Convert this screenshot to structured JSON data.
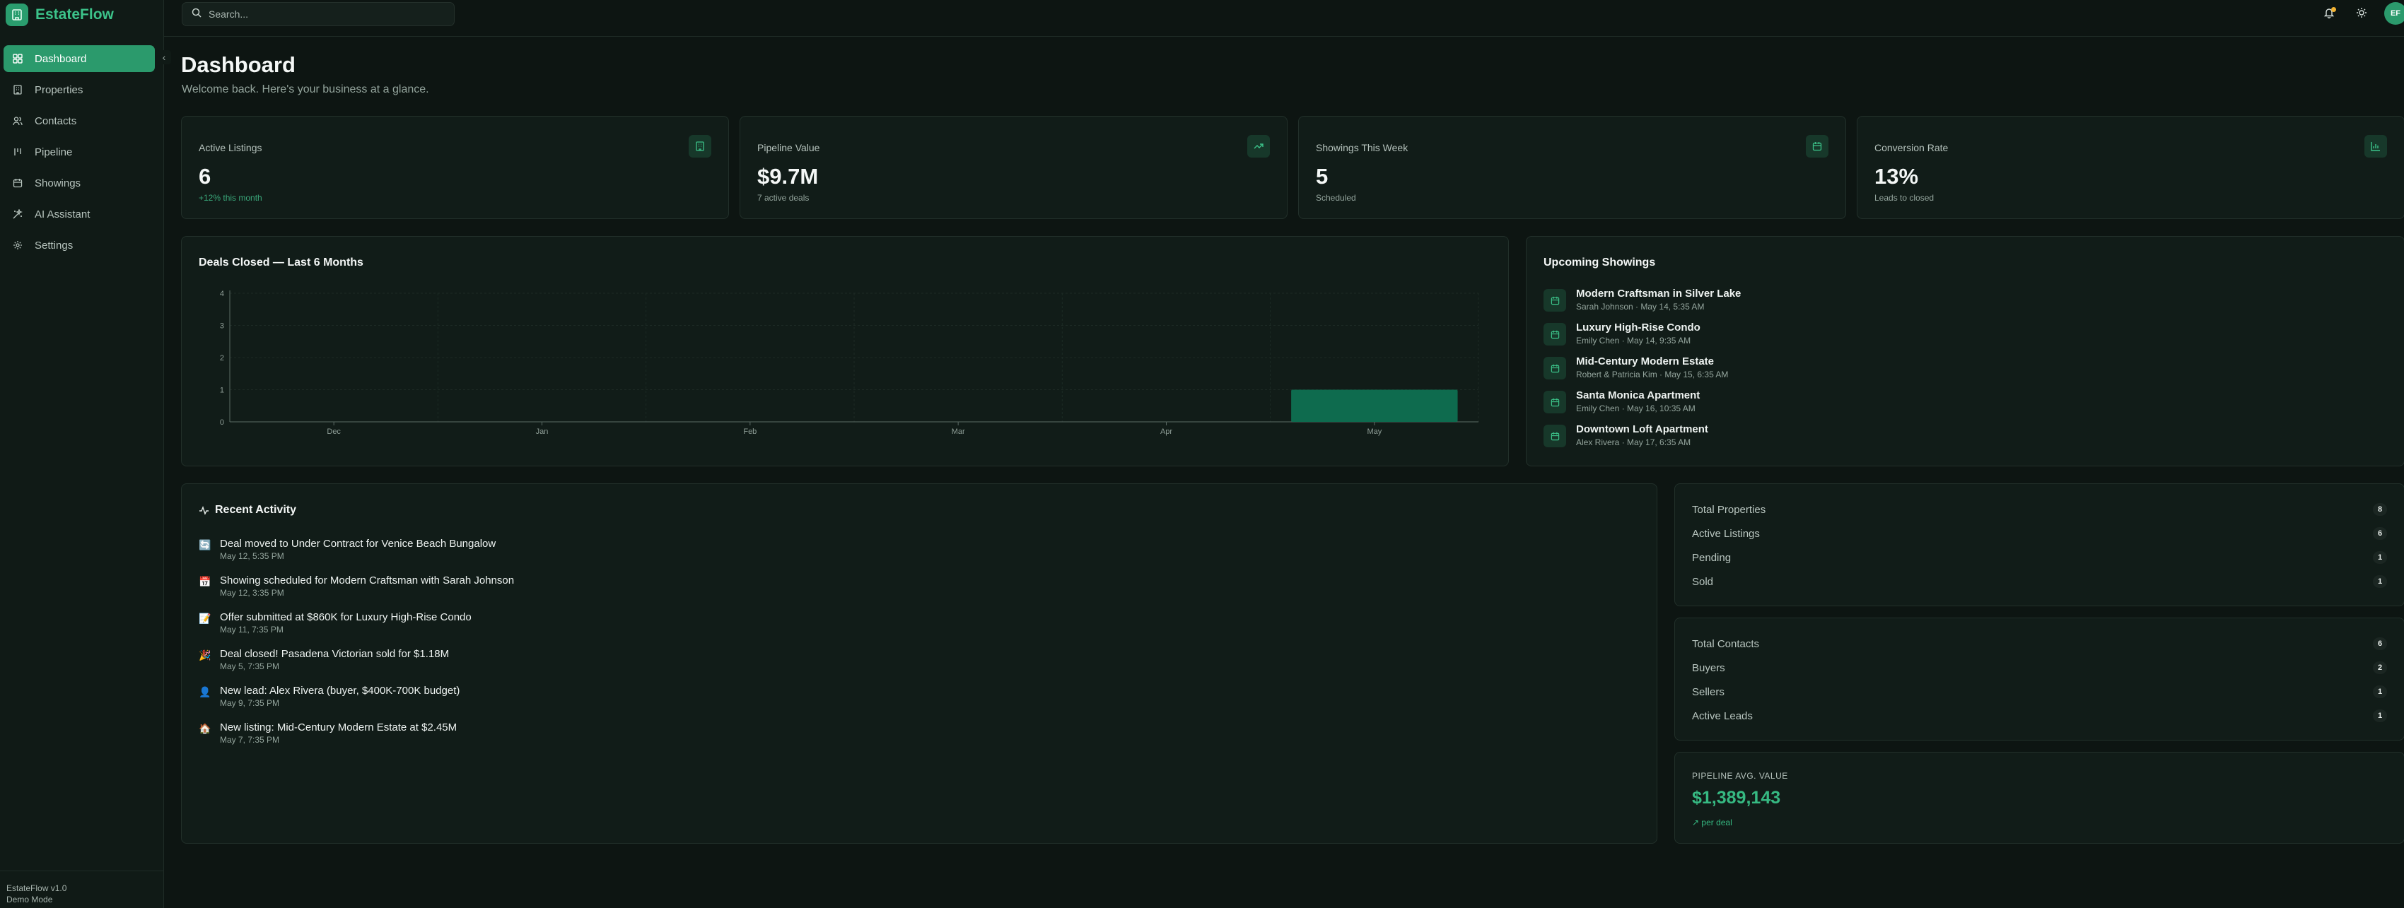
{
  "app": {
    "name": "EstateFlow",
    "version": "EstateFlow v1.0",
    "mode": "Demo Mode"
  },
  "search": {
    "placeholder": "Search..."
  },
  "user": {
    "initials": "EF"
  },
  "nav": {
    "items": [
      {
        "label": "Dashboard",
        "icon": "dashboard-icon",
        "active": true
      },
      {
        "label": "Properties",
        "icon": "building-icon"
      },
      {
        "label": "Contacts",
        "icon": "users-icon"
      },
      {
        "label": "Pipeline",
        "icon": "kanban-icon"
      },
      {
        "label": "Showings",
        "icon": "calendar-icon"
      },
      {
        "label": "AI Assistant",
        "icon": "sparkles-icon"
      },
      {
        "label": "Settings",
        "icon": "gear-icon"
      }
    ]
  },
  "header": {
    "title": "Dashboard",
    "subtitle": "Welcome back. Here's your business at a glance."
  },
  "kpis": [
    {
      "label": "Active Listings",
      "value": "6",
      "sub": "+12% this month",
      "icon": "building-icon"
    },
    {
      "label": "Pipeline Value",
      "value": "$9.7M",
      "sub": "7 active deals",
      "icon": "trending-up-icon"
    },
    {
      "label": "Showings This Week",
      "value": "5",
      "sub": "Scheduled",
      "icon": "calendar-icon"
    },
    {
      "label": "Conversion Rate",
      "value": "13%",
      "sub": "Leads to closed",
      "icon": "bar-chart-icon"
    }
  ],
  "chart_data": {
    "type": "bar",
    "title": "Deals Closed — Last 6 Months",
    "categories": [
      "Dec",
      "Jan",
      "Feb",
      "Mar",
      "Apr",
      "May"
    ],
    "values": [
      0,
      0,
      0,
      0,
      0,
      1
    ],
    "ylim": [
      0,
      4
    ],
    "yticks": [
      "0",
      "1",
      "2",
      "3",
      "4"
    ],
    "grid": true,
    "bar_color": "#0e6b4e"
  },
  "showings": {
    "title": "Upcoming Showings",
    "items": [
      {
        "title": "Modern Craftsman in Silver Lake",
        "meta": "Sarah Johnson · May 14, 5:35 AM"
      },
      {
        "title": "Luxury High-Rise Condo",
        "meta": "Emily Chen · May 14, 9:35 AM"
      },
      {
        "title": "Mid-Century Modern Estate",
        "meta": "Robert & Patricia Kim · May 15, 6:35 AM"
      },
      {
        "title": "Santa Monica Apartment",
        "meta": "Emily Chen · May 16, 10:35 AM"
      },
      {
        "title": "Downtown Loft Apartment",
        "meta": "Alex Rivera · May 17, 6:35 AM"
      }
    ]
  },
  "activity": {
    "title": "Recent Activity",
    "items": [
      {
        "emoji": "🔄",
        "title": "Deal moved to Under Contract for Venice Beach Bungalow",
        "time": "May 12, 5:35 PM"
      },
      {
        "emoji": "📅",
        "title": "Showing scheduled for Modern Craftsman with Sarah Johnson",
        "time": "May 12, 3:35 PM"
      },
      {
        "emoji": "📝",
        "title": "Offer submitted at $860K for Luxury High-Rise Condo",
        "time": "May 11, 7:35 PM"
      },
      {
        "emoji": "🎉",
        "title": "Deal closed! Pasadena Victorian sold for $1.18M",
        "time": "May 5, 7:35 PM"
      },
      {
        "emoji": "👤",
        "title": "New lead: Alex Rivera (buyer, $400K-700K budget)",
        "time": "May 9, 7:35 PM"
      },
      {
        "emoji": "🏠",
        "title": "New listing: Mid-Century Modern Estate at $2.45M",
        "time": "May 7, 7:35 PM"
      }
    ]
  },
  "property_stats": [
    {
      "label": "Total Properties",
      "value": "8"
    },
    {
      "label": "Active Listings",
      "value": "6"
    },
    {
      "label": "Pending",
      "value": "1"
    },
    {
      "label": "Sold",
      "value": "1"
    }
  ],
  "contact_stats": [
    {
      "label": "Total Contacts",
      "value": "6"
    },
    {
      "label": "Buyers",
      "value": "2"
    },
    {
      "label": "Sellers",
      "value": "1"
    },
    {
      "label": "Active Leads",
      "value": "1"
    }
  ],
  "pipeline_avg": {
    "label": "PIPELINE AVG. VALUE",
    "value": "$1,389,143",
    "sub": "↗ per deal"
  },
  "colors": {
    "accent": "#2b9a6c",
    "accent_text": "#3cc38a",
    "background": "#0d1512",
    "card": "#111c18",
    "notification": "#f1b233"
  }
}
